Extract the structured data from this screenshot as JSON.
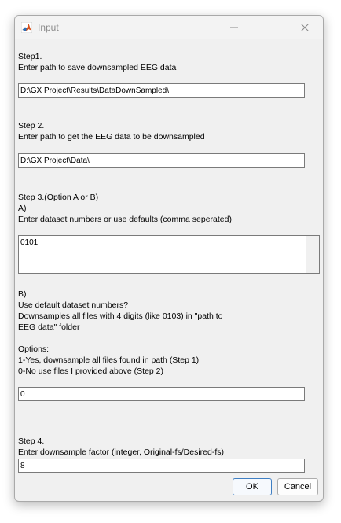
{
  "window": {
    "title": "Input"
  },
  "step1": {
    "heading": "Step1.",
    "prompt": "Enter path to save downsampled EEG data",
    "value": "D:\\GX Project\\Results\\DataDownSampled\\"
  },
  "step2": {
    "heading": "Step 2.",
    "prompt": "Enter path to get the EEG data to be downsampled",
    "value": "D:\\GX Project\\Data\\"
  },
  "step3": {
    "heading": "Step 3.(Option A or B)",
    "optionA": "A)",
    "promptA": "Enter dataset numbers  or use defaults (comma seperated)",
    "valueA": "0101",
    "optionB": "B)",
    "promptB1": "Use default dataset numbers?",
    "promptB2": "Downsamples all files with 4 digits (like 0103) in \"path to",
    "promptB3": "EEG data\" folder",
    "optionsLabel": "Options:",
    "option1": "1-Yes, downsample all files found in path (Step 1)",
    "option0": "0-No use files I provided above (Step 2)",
    "valueB": "0"
  },
  "step4": {
    "heading": "Step 4.",
    "prompt": "Enter downsample factor (integer, Original-fs/Desired-fs)",
    "value": "8"
  },
  "buttons": {
    "ok": "OK",
    "cancel": "Cancel"
  }
}
